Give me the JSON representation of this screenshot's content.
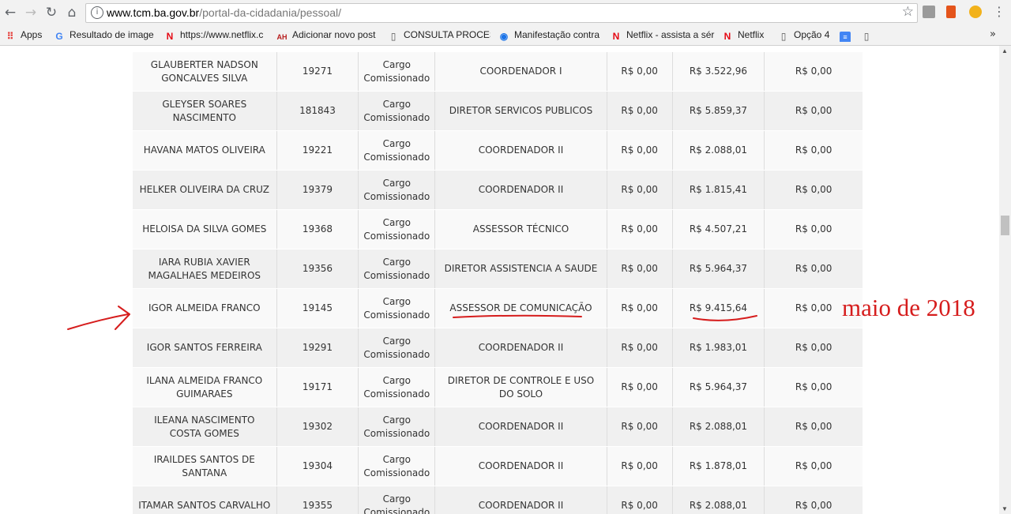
{
  "browser": {
    "url_host": "www.tcm.ba.gov.br",
    "url_path": "/portal-da-cidadania/pessoal/"
  },
  "bookmarks": [
    {
      "label": "Apps",
      "icon": "apps-grid-icon"
    },
    {
      "label": "Resultado de image",
      "icon": "google-icon"
    },
    {
      "label": "https://www.netflix.c",
      "icon": "netflix-icon"
    },
    {
      "label": "Adicionar novo post",
      "icon": "blog-icon"
    },
    {
      "label": "CONSULTA PROCESS",
      "icon": "page-icon"
    },
    {
      "label": "Manifestação contra",
      "icon": "globe-icon"
    },
    {
      "label": "Netflix - assista a sér",
      "icon": "netflix-icon"
    },
    {
      "label": "Netflix",
      "icon": "netflix-icon"
    },
    {
      "label": "Opção 4",
      "icon": "page-icon"
    }
  ],
  "more_bookmarks": "»",
  "rows": [
    {
      "name": "GLAUBERTER NADSON GONCALVES SILVA",
      "matricula": "19271",
      "vinculo": "Cargo Comissionado",
      "cargo": "COORDENADOR I",
      "v1": "R$ 0,00",
      "v2": "R$ 3.522,96",
      "v3": "R$ 0,00"
    },
    {
      "name": "GLEYSER SOARES NASCIMENTO",
      "matricula": "181843",
      "vinculo": "Cargo Comissionado",
      "cargo": "DIRETOR SERVICOS PUBLICOS",
      "v1": "R$ 0,00",
      "v2": "R$ 5.859,37",
      "v3": "R$ 0,00"
    },
    {
      "name": "HAVANA MATOS OLIVEIRA",
      "matricula": "19221",
      "vinculo": "Cargo Comissionado",
      "cargo": "COORDENADOR II",
      "v1": "R$ 0,00",
      "v2": "R$ 2.088,01",
      "v3": "R$ 0,00"
    },
    {
      "name": "HELKER OLIVEIRA DA CRUZ",
      "matricula": "19379",
      "vinculo": "Cargo Comissionado",
      "cargo": "COORDENADOR II",
      "v1": "R$ 0,00",
      "v2": "R$ 1.815,41",
      "v3": "R$ 0,00"
    },
    {
      "name": "HELOISA DA SILVA GOMES",
      "matricula": "19368",
      "vinculo": "Cargo Comissionado",
      "cargo": "ASSESSOR TÉCNICO",
      "v1": "R$ 0,00",
      "v2": "R$ 4.507,21",
      "v3": "R$ 0,00"
    },
    {
      "name": "IARA RUBIA XAVIER MAGALHAES MEDEIROS",
      "matricula": "19356",
      "vinculo": "Cargo Comissionado",
      "cargo": "DIRETOR ASSISTENCIA A SAUDE",
      "v1": "R$ 0,00",
      "v2": "R$ 5.964,37",
      "v3": "R$ 0,00"
    },
    {
      "name": "IGOR ALMEIDA FRANCO",
      "matricula": "19145",
      "vinculo": "Cargo Comissionado",
      "cargo": "ASSESSOR DE COMUNICAÇÃO",
      "v1": "R$ 0,00",
      "v2": "R$ 9.415,64",
      "v3": "R$ 0,00"
    },
    {
      "name": "IGOR SANTOS FERREIRA",
      "matricula": "19291",
      "vinculo": "Cargo Comissionado",
      "cargo": "COORDENADOR II",
      "v1": "R$ 0,00",
      "v2": "R$ 1.983,01",
      "v3": "R$ 0,00"
    },
    {
      "name": "ILANA ALMEIDA FRANCO GUIMARAES",
      "matricula": "19171",
      "vinculo": "Cargo Comissionado",
      "cargo": "DIRETOR DE CONTROLE E USO DO SOLO",
      "v1": "R$ 0,00",
      "v2": "R$ 5.964,37",
      "v3": "R$ 0,00"
    },
    {
      "name": "ILEANA NASCIMENTO COSTA GOMES",
      "matricula": "19302",
      "vinculo": "Cargo Comissionado",
      "cargo": "COORDENADOR II",
      "v1": "R$ 0,00",
      "v2": "R$ 2.088,01",
      "v3": "R$ 0,00"
    },
    {
      "name": "IRAILDES SANTOS DE SANTANA",
      "matricula": "19304",
      "vinculo": "Cargo Comissionado",
      "cargo": "COORDENADOR II",
      "v1": "R$ 0,00",
      "v2": "R$ 1.878,01",
      "v3": "R$ 0,00"
    },
    {
      "name": "ITAMAR SANTOS CARVALHO",
      "matricula": "19355",
      "vinculo": "Cargo Comissionado",
      "cargo": "COORDENADOR II",
      "v1": "R$ 0,00",
      "v2": "R$ 2.088,01",
      "v3": "R$ 0,00"
    }
  ],
  "annotation": {
    "text": "maio de 2018",
    "color": "#d61d1d"
  }
}
